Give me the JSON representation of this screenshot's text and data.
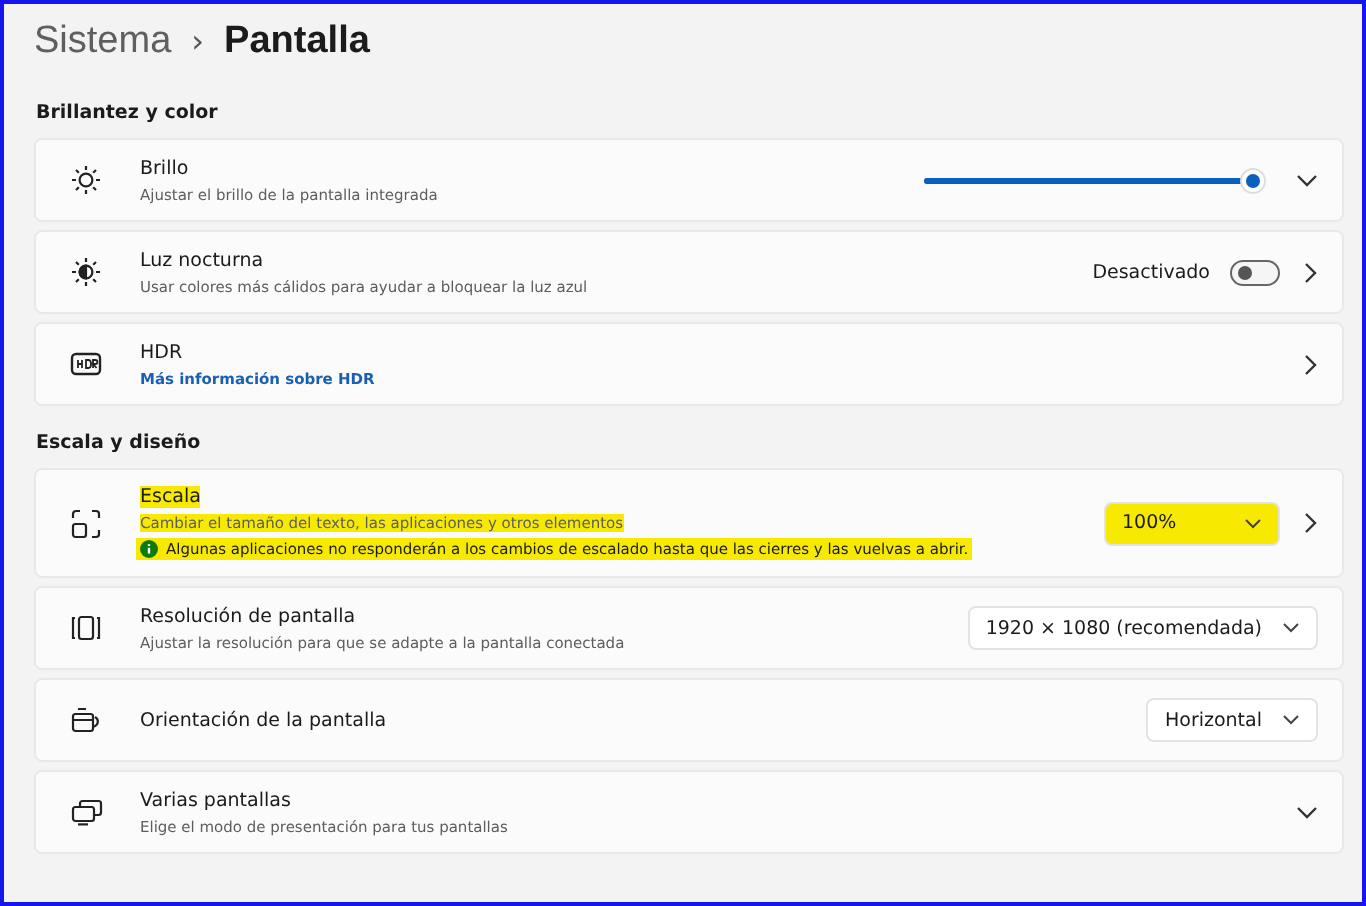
{
  "breadcrumb": {
    "parent": "Sistema",
    "separator": "›",
    "current": "Pantalla"
  },
  "sections": [
    {
      "title": "Brillantez y color",
      "cards": [
        {
          "title": "Brillo",
          "subtitle": "Ajustar el brillo de la pantalla integrada",
          "control": {
            "kind": "slider",
            "level": 0.97
          },
          "chevron": {
            "kind": "down"
          }
        },
        {
          "title": "Luz nocturna",
          "subtitle": "Usar colores más cálidos para ayudar a bloquear la luz azul",
          "control": {
            "kind": "toggle",
            "label": "Desactivado",
            "on": false
          },
          "chevron": {
            "kind": "right"
          }
        },
        {
          "title": "HDR",
          "link": "Más información sobre HDR",
          "chevron": {
            "kind": "right"
          }
        }
      ]
    },
    {
      "title": "Escala y diseño",
      "cards": [
        {
          "title": "Escala",
          "subtitle": "Cambiar el tamaño del texto, las aplicaciones y otros elementos",
          "note": "Algunas aplicaciones no responderán a los cambios de escalado hasta que las cierres y las vuelvas a abrir.",
          "highlighted": true,
          "control": {
            "kind": "dropdown",
            "value": "100%"
          },
          "chevron": {
            "kind": "right"
          }
        },
        {
          "title": "Resolución de pantalla",
          "subtitle": "Ajustar la resolución para que se adapte a la pantalla conectada",
          "highlighted": false,
          "control": {
            "kind": "dropdown",
            "value": "1920 × 1080 (recomendada)"
          }
        },
        {
          "title": "Orientación de la pantalla",
          "highlighted": false,
          "control": {
            "kind": "dropdown",
            "value": "Horizontal"
          }
        },
        {
          "title": "Varias pantallas",
          "subtitle": "Elige el modo de presentación para tus pantallas",
          "chevron": {
            "kind": "down"
          }
        }
      ]
    }
  ]
}
